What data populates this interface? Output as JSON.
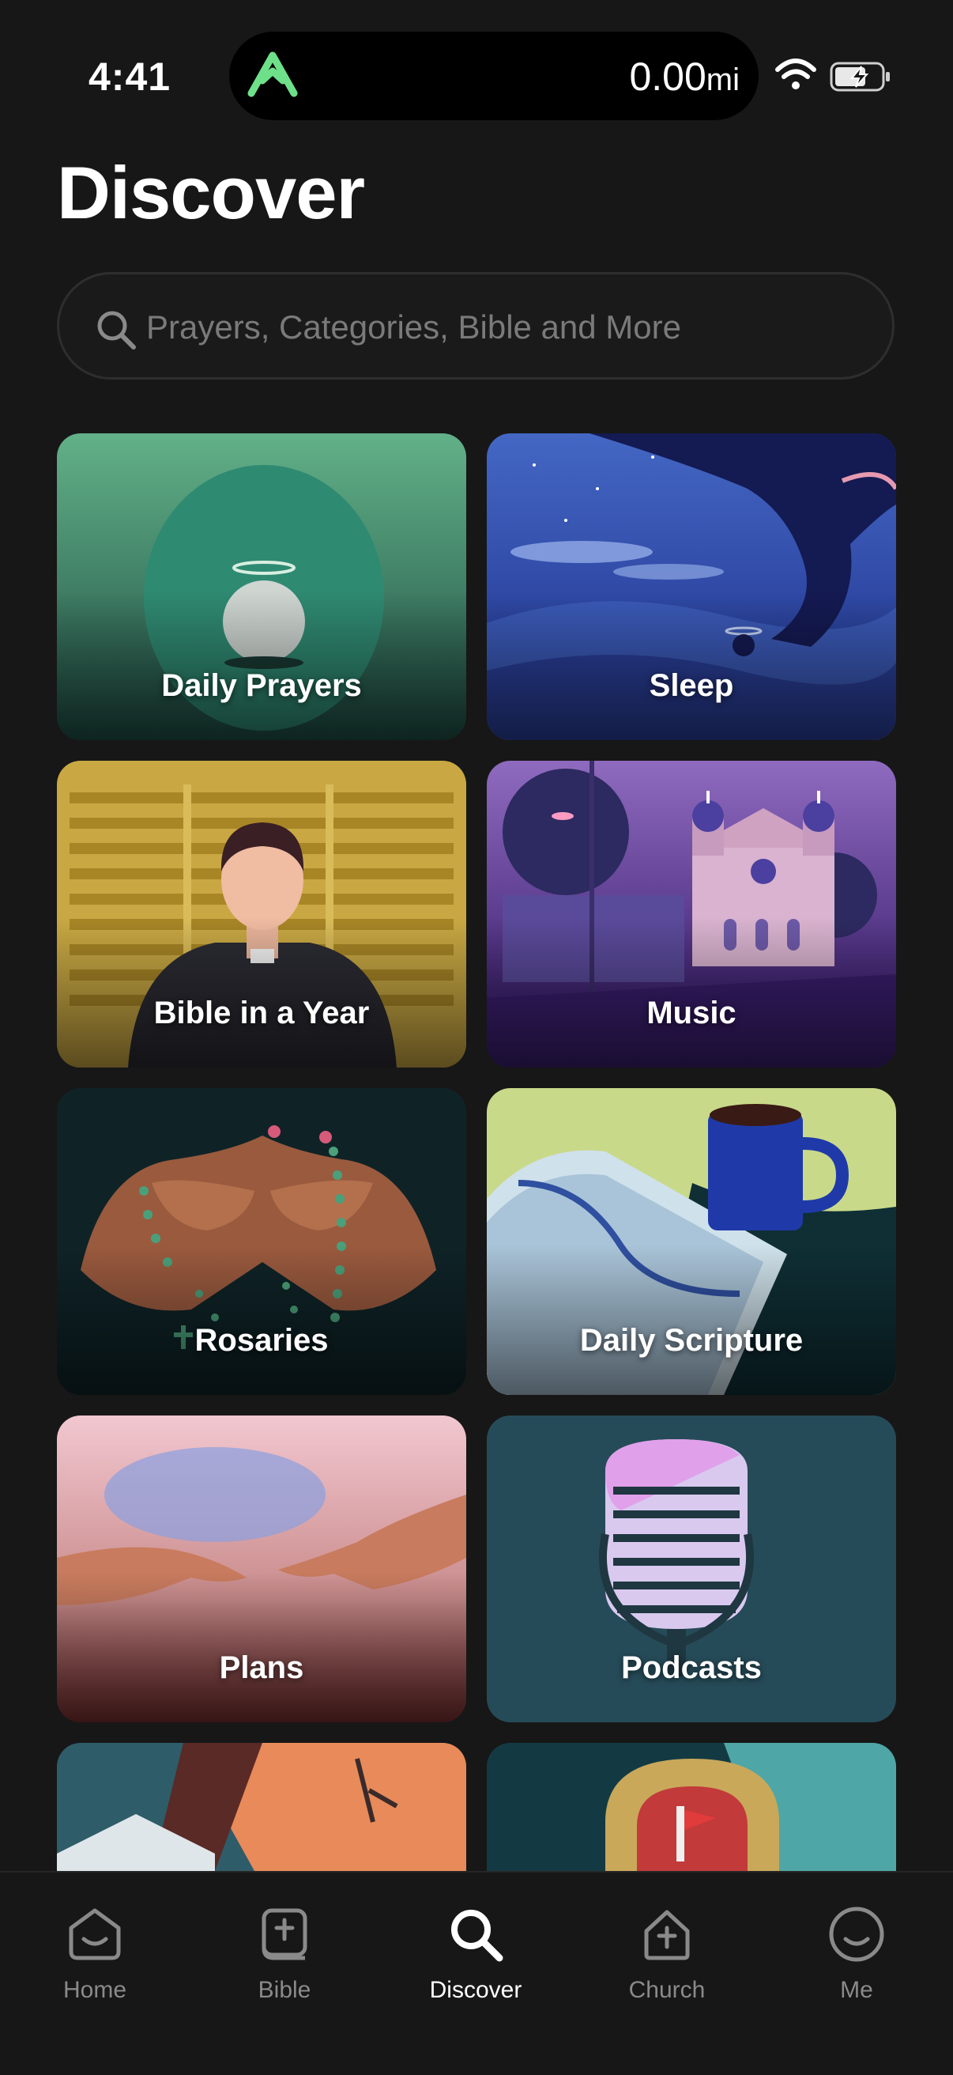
{
  "status_bar": {
    "time": "4:41",
    "distance": "0.00",
    "distance_unit": "mi"
  },
  "page": {
    "title": "Discover"
  },
  "search": {
    "placeholder": "Prayers, Categories, Bible and More"
  },
  "tiles": [
    {
      "label": "Daily Prayers"
    },
    {
      "label": "Sleep"
    },
    {
      "label": "Bible in a Year"
    },
    {
      "label": "Music"
    },
    {
      "label": "Rosaries"
    },
    {
      "label": "Daily Scripture"
    },
    {
      "label": "Plans"
    },
    {
      "label": "Podcasts"
    }
  ],
  "tab_bar": {
    "items": [
      {
        "label": "Home",
        "icon": "home-icon"
      },
      {
        "label": "Bible",
        "icon": "bible-icon"
      },
      {
        "label": "Discover",
        "icon": "search-icon",
        "active": true
      },
      {
        "label": "Church",
        "icon": "church-icon"
      },
      {
        "label": "Me",
        "icon": "profile-icon"
      }
    ]
  },
  "colors": {
    "background": "#171717",
    "accent_green": "#6fe08a"
  }
}
